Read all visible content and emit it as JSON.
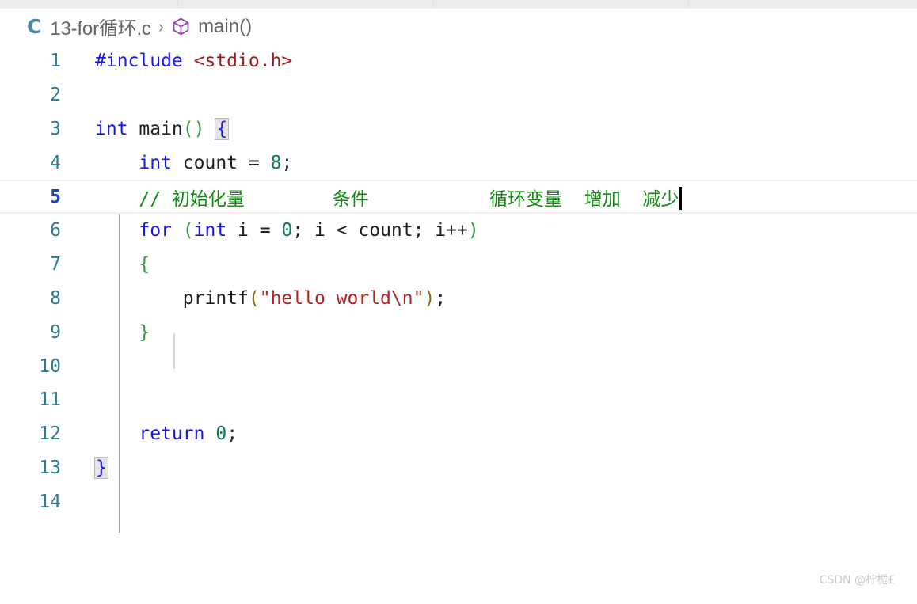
{
  "window": {
    "tabstrip": {
      "tabs": [
        {
          "name": "tab-slot-1"
        },
        {
          "name": "tab-slot-2"
        },
        {
          "name": "tab-slot-3"
        },
        {
          "name": "tab-slot-4"
        }
      ]
    }
  },
  "breadcrumb": {
    "file_icon_letter": "C",
    "filename": "13-for循环.c",
    "separator": "›",
    "symbol_icon": "symbol-method-cube-icon",
    "symbol": "main()"
  },
  "editor": {
    "language": "c",
    "active_line": 5,
    "caret_line": 5,
    "line_numbers": [
      1,
      2,
      3,
      4,
      5,
      6,
      7,
      8,
      9,
      10,
      11,
      12,
      13,
      14
    ],
    "lines": [
      {
        "num": 1,
        "text": "#include <stdio.h>"
      },
      {
        "num": 2,
        "text": ""
      },
      {
        "num": 3,
        "text": "int main() {"
      },
      {
        "num": 4,
        "text": "    int count = 8;"
      },
      {
        "num": 5,
        "text": "    // 初始化量        条件           循环变量  增加  减少"
      },
      {
        "num": 6,
        "text": "    for (int i = 0; i < count; i++)"
      },
      {
        "num": 7,
        "text": "    {"
      },
      {
        "num": 8,
        "text": "        printf(\"hello world\\n\");"
      },
      {
        "num": 9,
        "text": "    }"
      },
      {
        "num": 10,
        "text": ""
      },
      {
        "num": 11,
        "text": ""
      },
      {
        "num": 12,
        "text": "    return 0;"
      },
      {
        "num": 13,
        "text": "}"
      },
      {
        "num": 14,
        "text": ""
      }
    ],
    "tokens": {
      "l1_include": "#include",
      "l1_header": "<stdio.h>",
      "l3_int": "int",
      "l3_main": " main",
      "l3_parens": "()",
      "l3_brace": "{",
      "l4_int": "int",
      "l4_name": " count ",
      "l4_eq": "= ",
      "l4_num": "8",
      "l4_semi": ";",
      "l5_comment": "// 初始化量        条件           循环变量  增加  减少",
      "l6_for": "for",
      "l6_lparen": " (",
      "l6_int": "int",
      "l6_i": " i ",
      "l6_eq": "= ",
      "l6_zero": "0",
      "l6_mid": "; i < count; i++",
      "l6_rparen": ")",
      "l7_brace": "{",
      "l8_printf": "printf",
      "l8_lparen": "(",
      "l8_string": "\"hello world\\n\"",
      "l8_rparen": ")",
      "l8_semi": ";",
      "l9_brace": "}",
      "l12_return": "return",
      "l12_space": " ",
      "l12_num": "0",
      "l12_semi": ";",
      "l13_brace": "}"
    }
  },
  "watermark": {
    "text": "CSDN @柠栀£"
  },
  "colors": {
    "keyword": "#1515f0",
    "string": "#b32222",
    "header": "#a01b1b",
    "number": "#0a7a52",
    "comment": "#108a10",
    "brace_green": "#2e9b3f",
    "paren_gold": "#8a6d1a",
    "line_number": "#2c7c91",
    "active_line_number": "#1a47b8",
    "file_icon": "#4a87a8",
    "symbol_icon": "#8e44ad",
    "background": "#ffffff",
    "tabstrip": "#ececec"
  }
}
